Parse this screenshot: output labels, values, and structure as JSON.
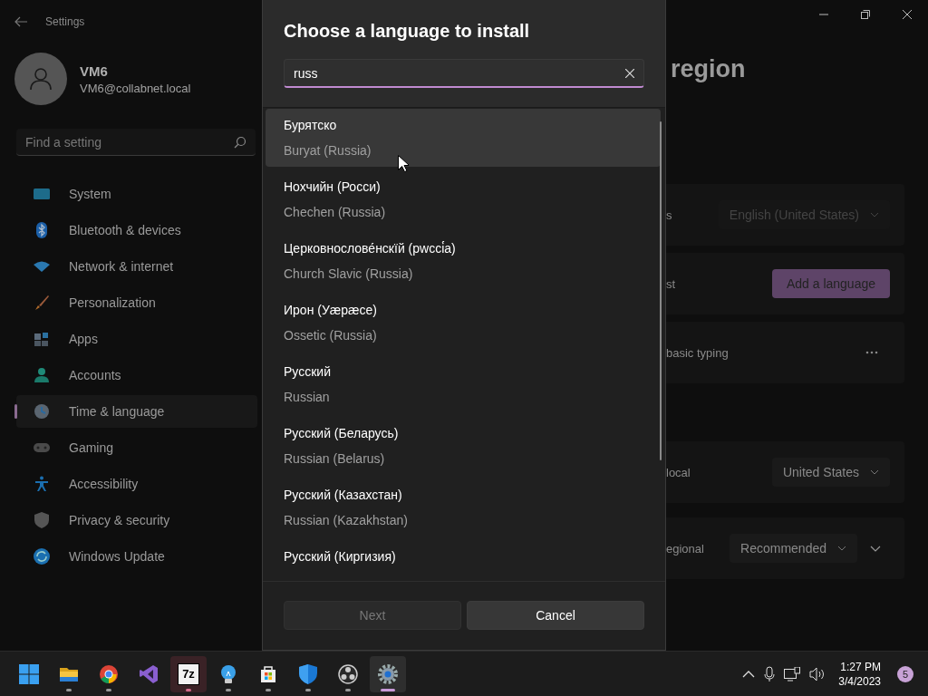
{
  "window": {
    "title": "Settings"
  },
  "user": {
    "name": "VM6",
    "email": "VM6@collabnet.local"
  },
  "search": {
    "placeholder": "Find a setting"
  },
  "sidebar": {
    "items": [
      {
        "kind": "system",
        "label": "System",
        "selected": false
      },
      {
        "kind": "bluetooth",
        "label": "Bluetooth & devices",
        "selected": false
      },
      {
        "kind": "network",
        "label": "Network & internet",
        "selected": false
      },
      {
        "kind": "personalization",
        "label": "Personalization",
        "selected": false
      },
      {
        "kind": "apps",
        "label": "Apps",
        "selected": false
      },
      {
        "kind": "accounts",
        "label": "Accounts",
        "selected": false
      },
      {
        "kind": "time",
        "label": "Time & language",
        "selected": true
      },
      {
        "kind": "gaming",
        "label": "Gaming",
        "selected": false
      },
      {
        "kind": "accessibility",
        "label": "Accessibility",
        "selected": false
      },
      {
        "kind": "privacy",
        "label": "Privacy & security",
        "selected": false
      },
      {
        "kind": "update",
        "label": "Windows Update",
        "selected": false
      }
    ]
  },
  "page": {
    "title": "region",
    "rows": [
      {
        "label": "s",
        "kind": "dropdown",
        "value": "English (United States)",
        "disabled": true,
        "expandable": false
      },
      {
        "label": "st",
        "kind": "button",
        "value": "Add a language",
        "disabled": false,
        "expandable": false
      },
      {
        "label": "basic typing",
        "kind": "more",
        "disabled": false,
        "expandable": false
      },
      {
        "label": "local",
        "kind": "dropdown",
        "value": "United States",
        "disabled": false,
        "expandable": false
      },
      {
        "label": "egional",
        "kind": "dropdown",
        "value": "Recommended",
        "disabled": false,
        "expandable": true
      }
    ]
  },
  "dialog": {
    "title": "Choose a language to install",
    "search": {
      "value": "russ"
    },
    "languages": [
      {
        "native": "Бурятско",
        "english": "Buryat (Russia)",
        "hovered": true
      },
      {
        "native": "Нохчийн (Росси)",
        "english": "Chechen (Russia)",
        "hovered": false
      },
      {
        "native": "Церковнослове́нскїй (рwссі́а)",
        "english": "Church Slavic (Russia)",
        "hovered": false
      },
      {
        "native": "Ирон (Уæрæсе)",
        "english": "Ossetic (Russia)",
        "hovered": false
      },
      {
        "native": "Русский",
        "english": "Russian",
        "hovered": false
      },
      {
        "native": "Русский (Беларусь)",
        "english": "Russian (Belarus)",
        "hovered": false
      },
      {
        "native": "Русский (Казахстан)",
        "english": "Russian (Kazakhstan)",
        "hovered": false
      },
      {
        "native": "Русский (Киргизия)",
        "hovered": false
      }
    ],
    "buttons": [
      {
        "label": "Next",
        "disabled": true
      },
      {
        "label": "Cancel",
        "disabled": false
      }
    ]
  },
  "taskbar": {
    "apps": [
      {
        "kind": "explorer",
        "running": true,
        "flashing": false,
        "active": false
      },
      {
        "kind": "browser",
        "running": true,
        "flashing": false,
        "active": false
      },
      {
        "kind": "studio",
        "running": false,
        "flashing": false,
        "active": false
      },
      {
        "kind": "archiver",
        "label": "7z",
        "running": true,
        "flashing": true,
        "active": false
      },
      {
        "kind": "bulb",
        "running": true,
        "flashing": false,
        "active": false
      },
      {
        "kind": "store",
        "running": true,
        "flashing": false,
        "active": false
      },
      {
        "kind": "defender",
        "running": true,
        "flashing": false,
        "active": false
      },
      {
        "kind": "recorder",
        "running": true,
        "flashing": false,
        "active": false
      },
      {
        "kind": "settings",
        "running": true,
        "flashing": false,
        "active": true
      }
    ],
    "tray": {
      "time": "1:27 PM",
      "date": "3/4/2023",
      "badge": "5"
    }
  }
}
